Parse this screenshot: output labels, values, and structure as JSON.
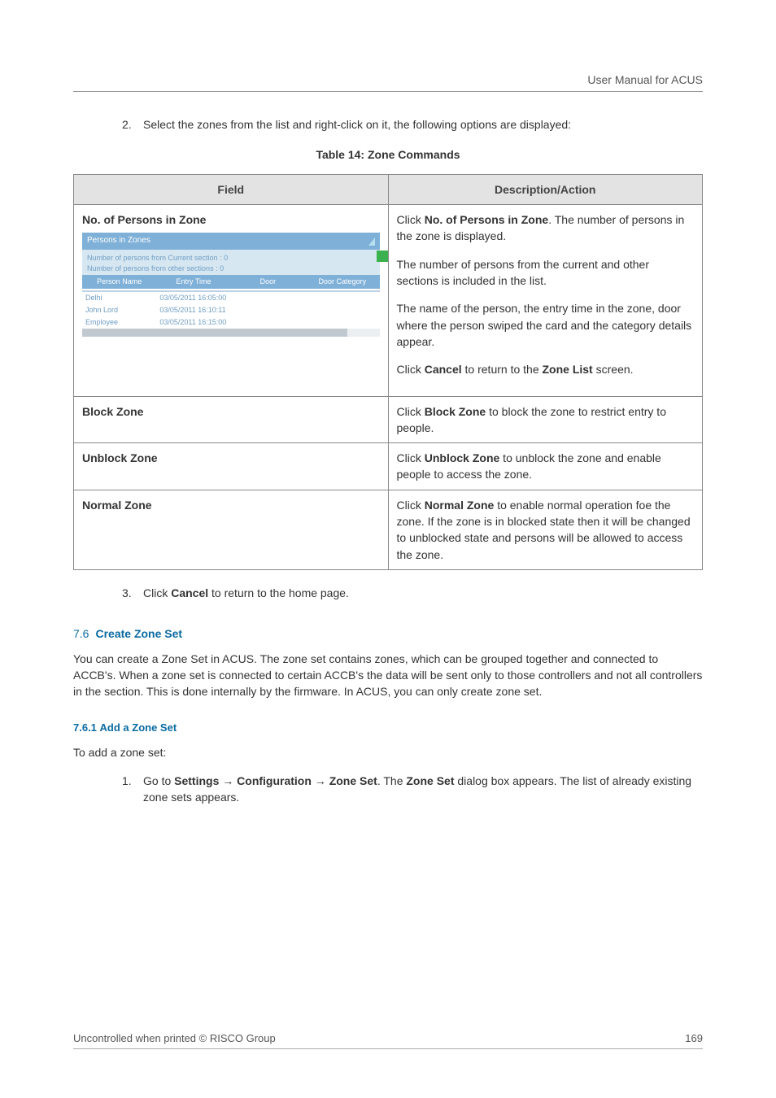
{
  "header": {
    "title": "User Manual for ACUS"
  },
  "steps": {
    "s2_num": "2.",
    "s2_text": "Select the zones from the list and right-click on it, the following options are displayed:",
    "s3_num": "3.",
    "s3_text_a": "Click ",
    "s3_cancel": "Cancel",
    "s3_text_b": " to return to the home page."
  },
  "table": {
    "caption": "Table 14: Zone Commands",
    "head_field": "Field",
    "head_desc": "Description/Action",
    "row1": {
      "field": "No. of Persons in Zone",
      "desc_a": "Click ",
      "desc_b": "No. of Persons in Zone",
      "desc_c": ". The number of persons in the zone is displayed.",
      "desc_d": "The number of persons from the current and other sections is included in the list.",
      "desc_e": "The name of the person, the entry time in the zone, door where the person swiped the card and the category details appear.",
      "desc_f_a": "Click ",
      "desc_f_b": "Cancel",
      "desc_f_c": " to return to the ",
      "desc_f_d": "Zone List",
      "desc_f_e": " screen."
    },
    "row2": {
      "field": "Block Zone",
      "desc_a": "Click ",
      "desc_b": "Block Zone",
      "desc_c": " to block the zone to restrict entry to people."
    },
    "row3": {
      "field": "Unblock Zone",
      "desc_a": "Click ",
      "desc_b": "Unblock Zone",
      "desc_c": " to unblock the zone and enable people to access the zone."
    },
    "row4": {
      "field": "Normal Zone",
      "desc_a": "Click ",
      "desc_b": "Normal Zone",
      "desc_c": " to enable normal operation foe the zone. If the zone is in blocked state then it will be changed to unblocked state and persons will be allowed to access the zone."
    }
  },
  "screenshot": {
    "title": "Persons in Zones",
    "line1": "Number of persons from Current section : 0",
    "line2": "Number of persons from other sections : 0",
    "col1": "Person Name",
    "col2": "Entry Time",
    "col3": "Door",
    "col4": "Door Category",
    "rows": [
      {
        "c1": "",
        "c2": "",
        "c3": "",
        "c4": ""
      },
      {
        "c1": "",
        "c2": "",
        "c3": "",
        "c4": ""
      },
      {
        "c1": "Delhi",
        "c2": "03/05/2011 16:05:00",
        "c3": "",
        "c4": ""
      },
      {
        "c1": "John Lord",
        "c2": "03/05/2011 16:10:11",
        "c3": "",
        "c4": ""
      },
      {
        "c1": "Employee",
        "c2": "03/05/2011 16:15:00",
        "c3": "",
        "c4": ""
      }
    ]
  },
  "sections": {
    "s76_num": "7.6",
    "s76_title": "Create Zone Set",
    "s76_body": "You can create a Zone Set in ACUS. The zone set contains zones, which can be grouped together and connected to ACCB's. When a zone set is connected to certain ACCB's the data will be sent only to those controllers and not all controllers in the section. This is done internally by the firmware. In ACUS, you can only create zone set.",
    "s761_num": "7.6.1",
    "s761_title": "Add a Zone Set",
    "s761_intro": "To add a zone set:",
    "s761_step1_num": "1.",
    "s761_step1_a": "Go to ",
    "s761_step1_b": "Settings",
    "s761_step1_c": " → ",
    "s761_step1_d": "Configuration",
    "s761_step1_e": " → ",
    "s761_step1_f": "Zone Set",
    "s761_step1_g": ". The ",
    "s761_step1_h": "Zone Set",
    "s761_step1_i": " dialog box appears. The list of already existing zone sets appears."
  },
  "footer": {
    "left": "Uncontrolled when printed © RISCO Group",
    "right": "169"
  }
}
